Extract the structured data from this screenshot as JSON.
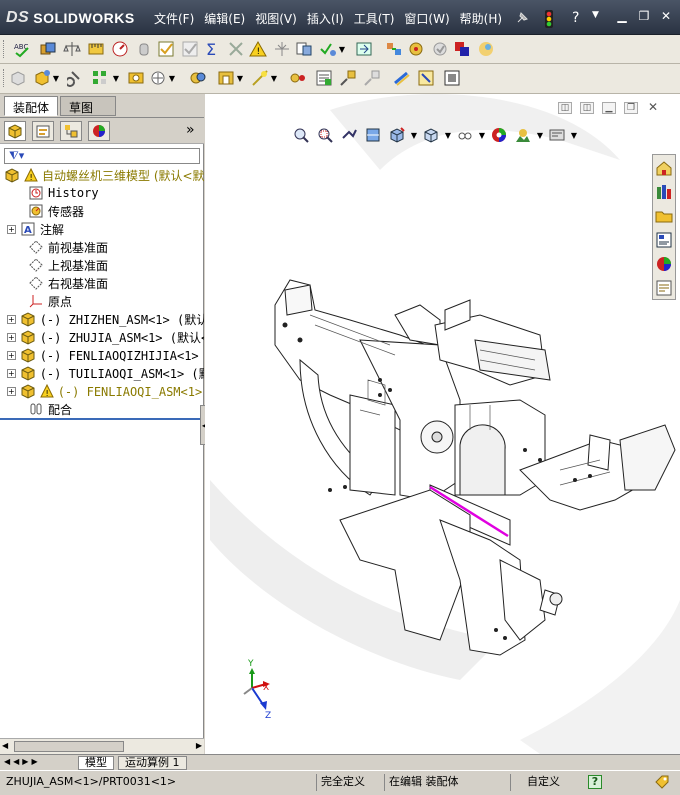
{
  "app": {
    "logo_prefix": "DS",
    "logo_text": "SOLIDWORKS"
  },
  "menu": [
    "文件(F)",
    "编辑(E)",
    "视图(V)",
    "插入(I)",
    "工具(T)",
    "窗口(W)",
    "帮助(H)"
  ],
  "panel_tabs": {
    "assembly": "装配体",
    "drawing": "草图"
  },
  "tree": {
    "root": "自动螺丝机三维模型 (默认<默",
    "items": [
      {
        "label": "History",
        "type": "history"
      },
      {
        "label": "传感器",
        "type": "sensor"
      },
      {
        "label": "注解",
        "type": "annotation"
      },
      {
        "label": "前视基准面",
        "type": "plane"
      },
      {
        "label": "上视基准面",
        "type": "plane"
      },
      {
        "label": "右视基准面",
        "type": "plane"
      },
      {
        "label": "原点",
        "type": "origin"
      },
      {
        "label": "(-) ZHIZHEN_ASM<1> (默认<默",
        "type": "subasm"
      },
      {
        "label": "(-) ZHUJIA_ASM<1> (默认<默",
        "type": "subasm"
      },
      {
        "label": "(-) FENLIAOQIZHIJIA<1> (默认",
        "type": "subasm"
      },
      {
        "label": "(-) TUILIAOQI_ASM<1> (默认<",
        "type": "subasm"
      },
      {
        "label": "(-) FENLIAOQI_ASM<1> (默",
        "type": "subasm-warn"
      },
      {
        "label": "配合",
        "type": "mates"
      }
    ]
  },
  "bottom_tabs": {
    "model": "模型",
    "motion": "运动算例 1"
  },
  "status": {
    "selection": "ZHUJIA_ASM<1>/PRT0031<1>",
    "definition": "完全定义",
    "editing": "在编辑 装配体",
    "units": "自定义",
    "help": "?"
  },
  "axis_labels": {
    "x": "X",
    "y": "Y",
    "z": "Z"
  },
  "colors": {
    "titlebar": "#3a4454",
    "highlight_edge": "#e000e0",
    "tree_separator": "#3a6ab8"
  }
}
